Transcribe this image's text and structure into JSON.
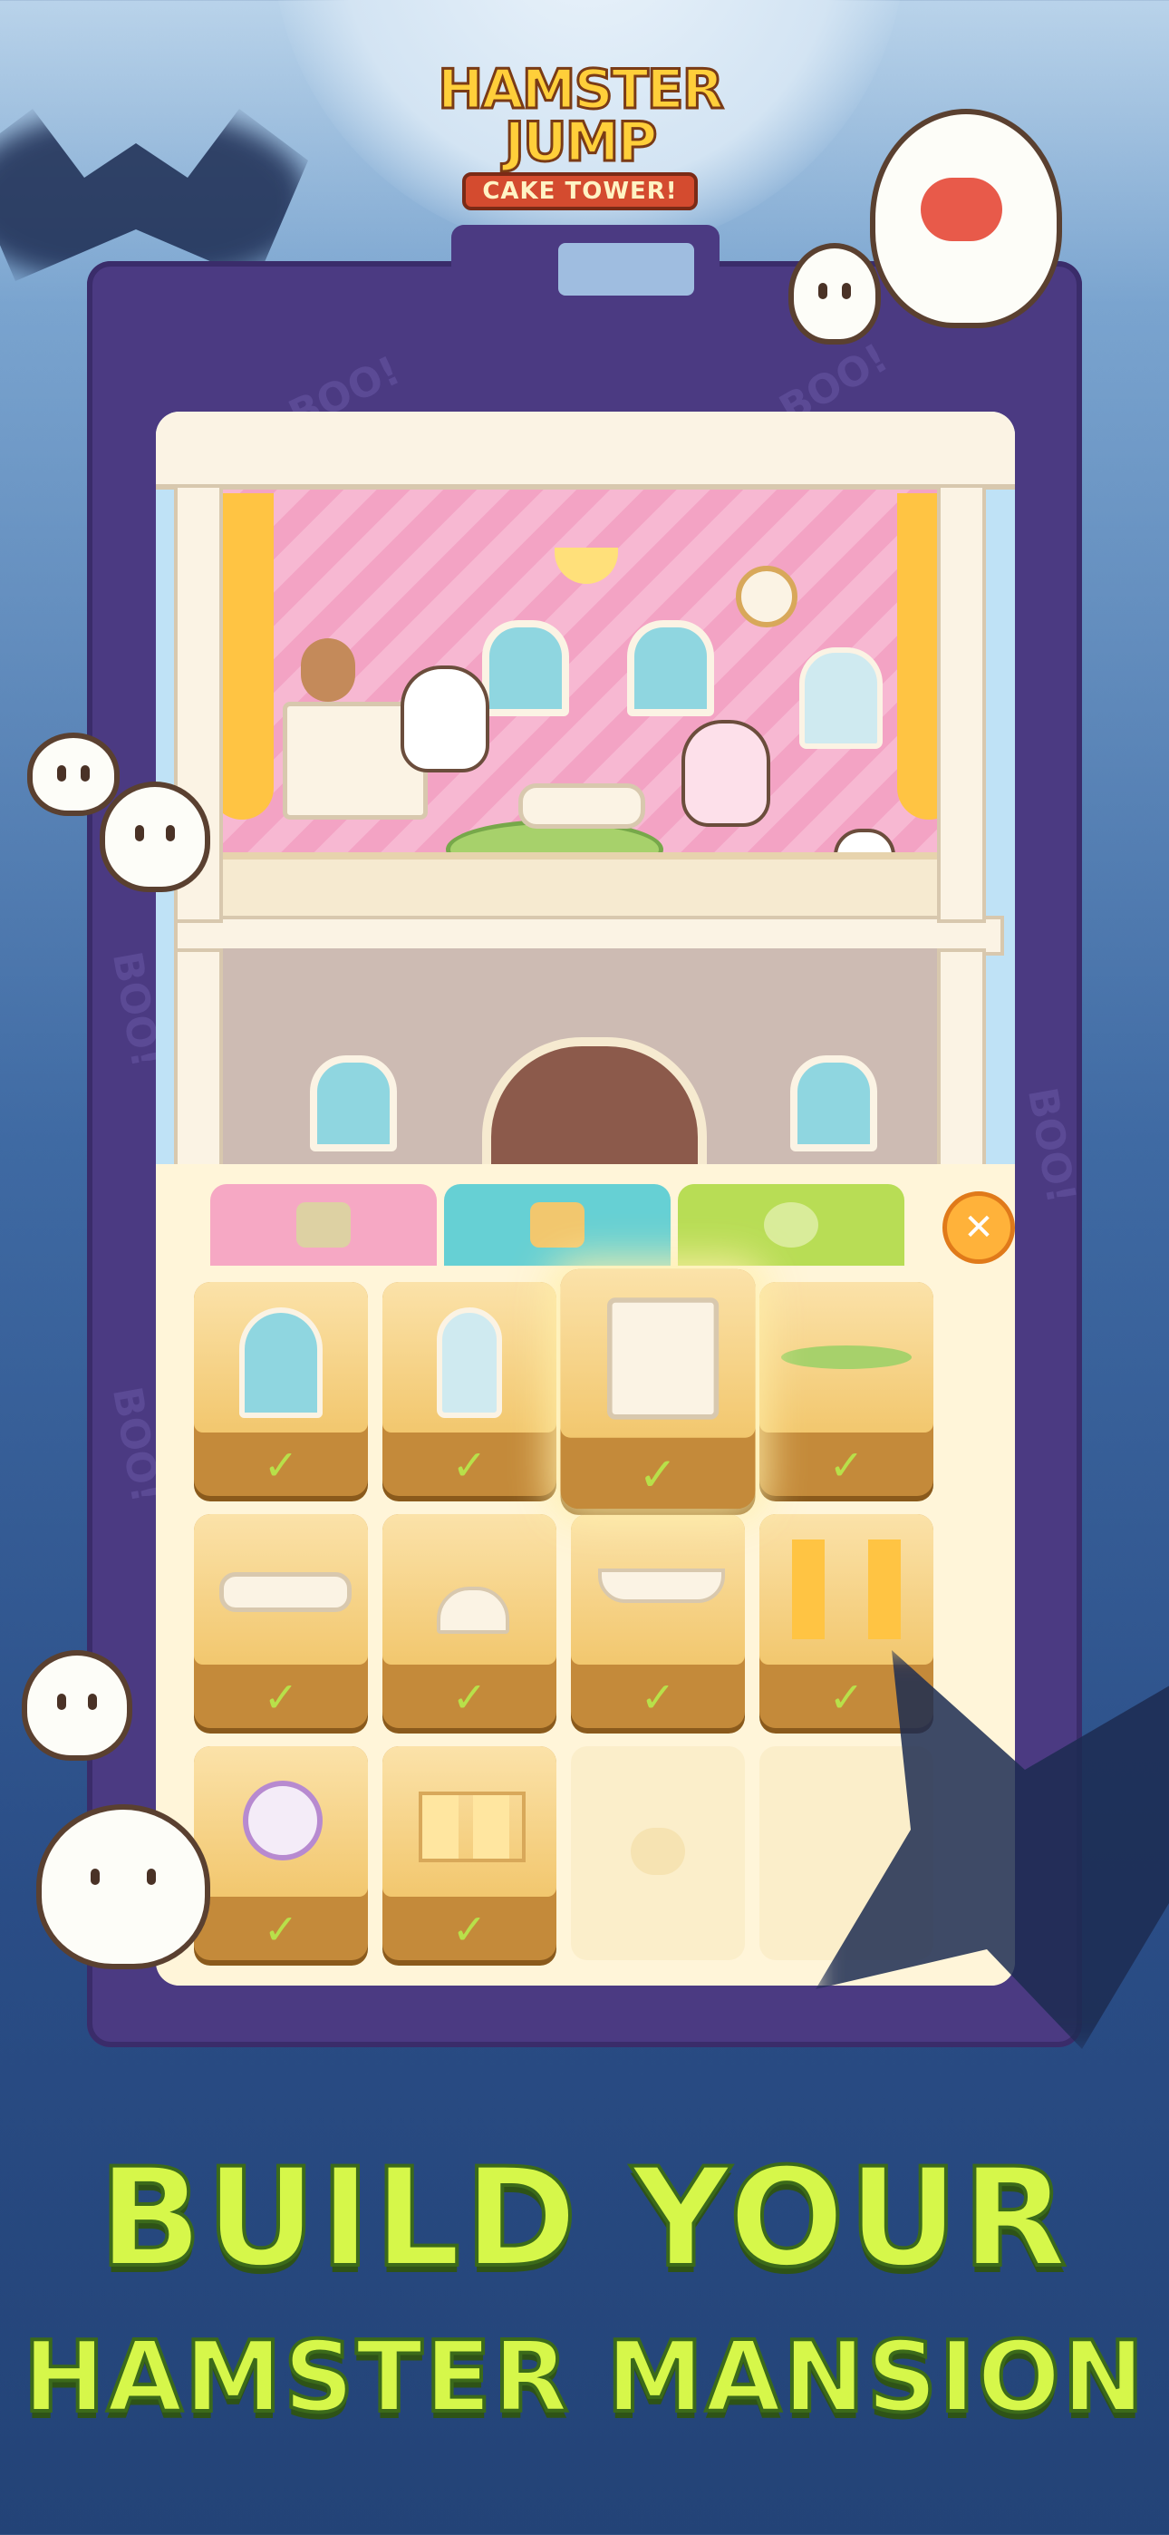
{
  "logo": {
    "line1": "HAMSTER",
    "line2": "JUMP",
    "line3": "CAKE TOWER!"
  },
  "frame_deco": {
    "boo_text": "BOO!"
  },
  "panel": {
    "tabs": [
      {
        "name": "characters",
        "icon": "hamster-icon",
        "color": "#f6a8c4"
      },
      {
        "name": "furniture",
        "icon": "dresser-icon",
        "color": "#66d0d4"
      },
      {
        "name": "decor",
        "icon": "plate-icon",
        "color": "#b8dd55"
      }
    ],
    "close_label": "✕",
    "items": [
      {
        "name": "window",
        "icon": "window-icon",
        "owned": true,
        "check": "✓"
      },
      {
        "name": "vanity-mirror",
        "icon": "vanity-icon",
        "owned": true,
        "check": "✓"
      },
      {
        "name": "dresser-with-teddy",
        "icon": "dresser-icon",
        "owned": true,
        "selected": true,
        "check": "✓"
      },
      {
        "name": "green-rug",
        "icon": "rug-icon",
        "owned": true,
        "check": "✓"
      },
      {
        "name": "coffee-table",
        "icon": "table-icon",
        "owned": true,
        "check": "✓"
      },
      {
        "name": "ceiling-lamp",
        "icon": "lamp-icon",
        "owned": true,
        "check": "✓"
      },
      {
        "name": "valance",
        "icon": "valance-icon",
        "owned": true,
        "check": "✓"
      },
      {
        "name": "curtains",
        "icon": "curtain-icon",
        "owned": true,
        "check": "✓"
      },
      {
        "name": "wall-clock",
        "icon": "clock-icon",
        "owned": true,
        "check": "✓"
      },
      {
        "name": "wall-frames",
        "icon": "frames-icon",
        "owned": true,
        "check": "✓"
      },
      {
        "name": "empty-slot-1",
        "icon": "hamster-silhouette-icon",
        "owned": false,
        "check": ""
      },
      {
        "name": "empty-slot-2",
        "icon": "",
        "owned": false,
        "check": ""
      }
    ]
  },
  "headline": {
    "line1": "BUILD YOUR",
    "line2": "HAMSTER MANSION"
  },
  "colors": {
    "headline_fill": "#d6f74a",
    "frame": "#4b3a82",
    "check": "#b8e04a"
  }
}
